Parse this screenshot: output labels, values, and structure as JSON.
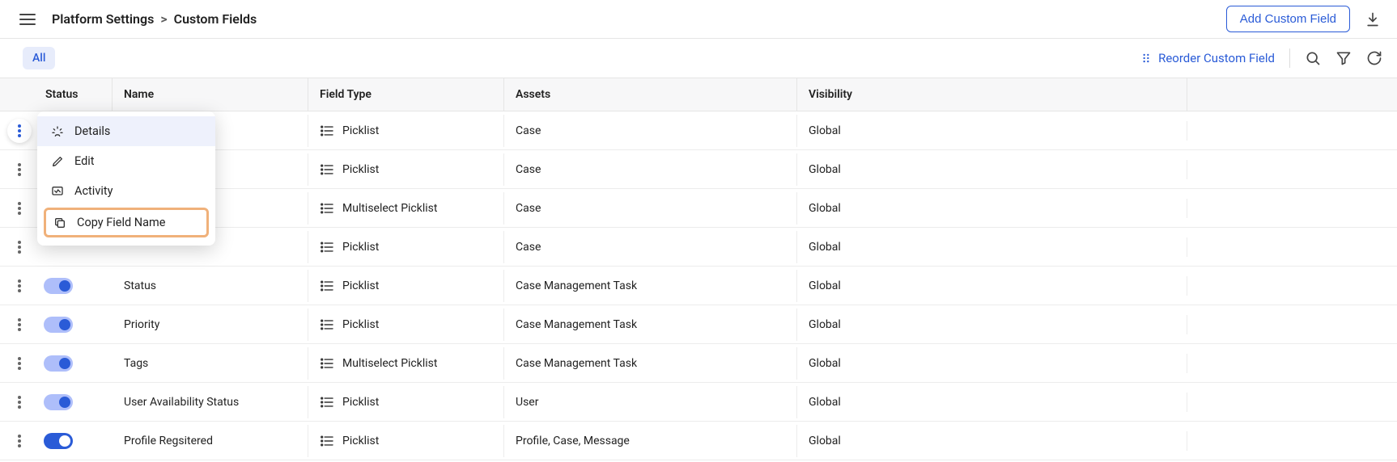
{
  "breadcrumb": {
    "parent": "Platform Settings",
    "current": "Custom Fields"
  },
  "buttons": {
    "add_custom_field": "Add Custom Field",
    "reorder": "Reorder Custom Field"
  },
  "filter": {
    "all": "All"
  },
  "columns": {
    "status": "Status",
    "name": "Name",
    "field_type": "Field Type",
    "assets": "Assets",
    "visibility": "Visibility"
  },
  "menu": {
    "details": "Details",
    "edit": "Edit",
    "activity": "Activity",
    "copy_field_name": "Copy Field Name"
  },
  "rows": [
    {
      "name": "",
      "field_type": "Picklist",
      "assets": "Case",
      "visibility": "Global",
      "toggle": "hidden"
    },
    {
      "name": "",
      "field_type": "Picklist",
      "assets": "Case",
      "visibility": "Global",
      "toggle": "hidden"
    },
    {
      "name": "",
      "field_type": "Multiselect Picklist",
      "assets": "Case",
      "visibility": "Global",
      "toggle": "hidden"
    },
    {
      "name": "",
      "field_type": "Picklist",
      "assets": "Case",
      "visibility": "Global",
      "toggle": "hidden"
    },
    {
      "name": "Status",
      "field_type": "Picklist",
      "assets": "Case Management Task",
      "visibility": "Global",
      "toggle": "light"
    },
    {
      "name": "Priority",
      "field_type": "Picklist",
      "assets": "Case Management Task",
      "visibility": "Global",
      "toggle": "light"
    },
    {
      "name": "Tags",
      "field_type": "Multiselect Picklist",
      "assets": "Case Management Task",
      "visibility": "Global",
      "toggle": "light"
    },
    {
      "name": "User Availability Status",
      "field_type": "Picklist",
      "assets": "User",
      "visibility": "Global",
      "toggle": "light"
    },
    {
      "name": "Profile Regsitered",
      "field_type": "Picklist",
      "assets": "Profile, Case, Message",
      "visibility": "Global",
      "toggle": "dark"
    }
  ]
}
